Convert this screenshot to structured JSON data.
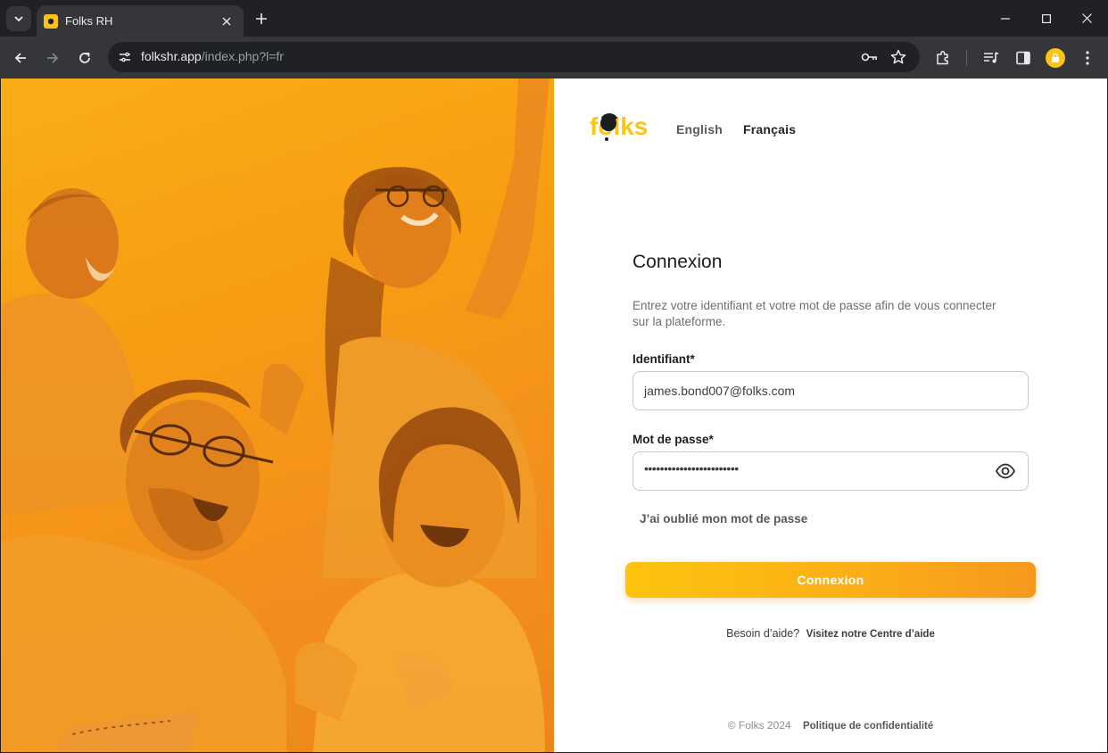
{
  "browser": {
    "tab_title": "Folks RH",
    "url_host": "folkshr.app",
    "url_path": "/index.php?l=fr"
  },
  "header": {
    "logo_text": "folks",
    "languages": [
      "English",
      "Français"
    ],
    "active_language": "Français"
  },
  "login": {
    "title": "Connexion",
    "description": "Entrez votre identifiant et votre mot de passe afin de vous connecter sur la plateforme.",
    "identifier_label": "Identifiant*",
    "identifier_value": "james.bond007@folks.com",
    "password_label": "Mot de passe*",
    "password_masked": "••••••••••••••••••••••••",
    "forgot_password": "J’ai oublié mon mot de passe",
    "submit_label": "Connexion"
  },
  "help": {
    "question": "Besoin d’aide?",
    "link": "Visitez notre Centre d’aide"
  },
  "footer": {
    "copyright": "© Folks 2024",
    "privacy": "Politique de confidentialité"
  },
  "colors": {
    "brand_yellow": "#fcc419",
    "brand_orange": "#f7981e",
    "chrome_dark": "#202124",
    "chrome_mid": "#35363a"
  }
}
